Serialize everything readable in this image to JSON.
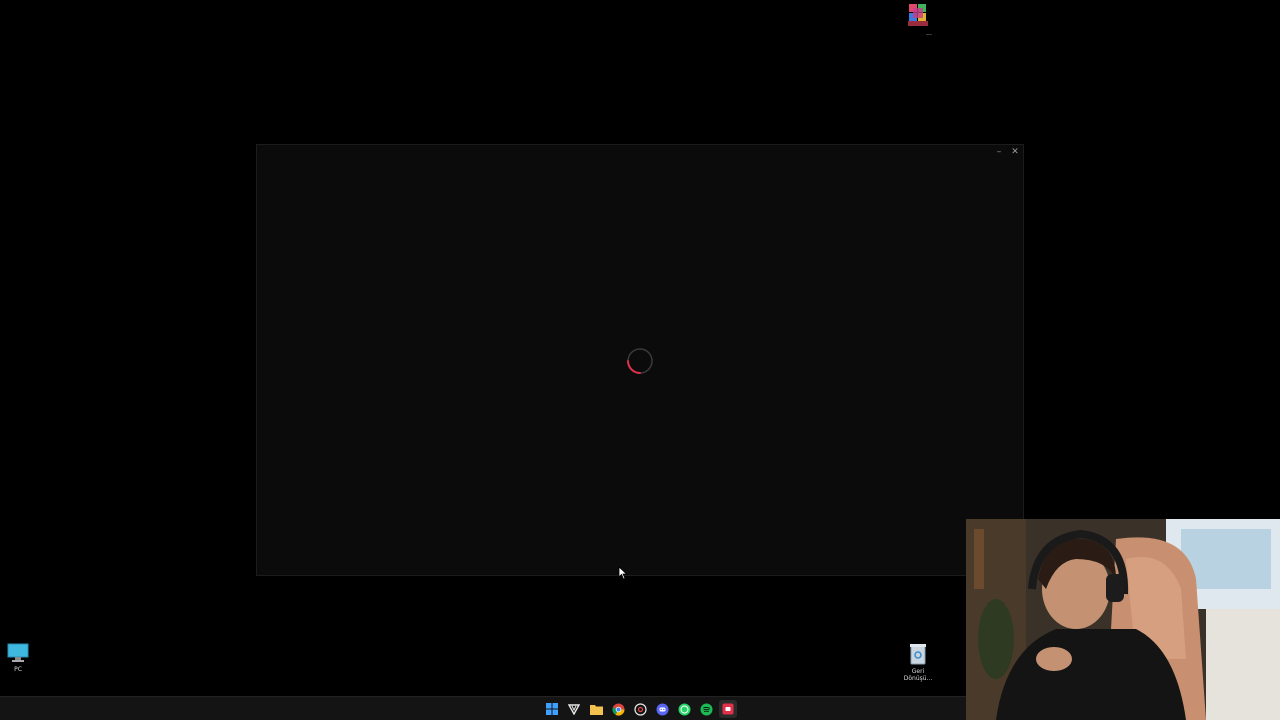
{
  "desktop": {
    "icons": [
      {
        "id": "app",
        "label": "..."
      },
      {
        "id": "pc",
        "label": "PC"
      },
      {
        "id": "recycle_bin",
        "label": "Geri\nDönüşü..."
      }
    ]
  },
  "window": {
    "minimize_label": "–",
    "close_label": "✕",
    "state": "loading"
  },
  "taskbar": {
    "apps": [
      "start",
      "search",
      "file-explorer",
      "chrome",
      "chrome-alt",
      "discord",
      "whatsapp",
      "spotify",
      "app-red"
    ]
  },
  "colors": {
    "spinner_accent": "#e0304a",
    "spinner_track": "#3a3a3a",
    "taskbar_bg": "#141414",
    "window_bg": "#0b0b0b"
  }
}
